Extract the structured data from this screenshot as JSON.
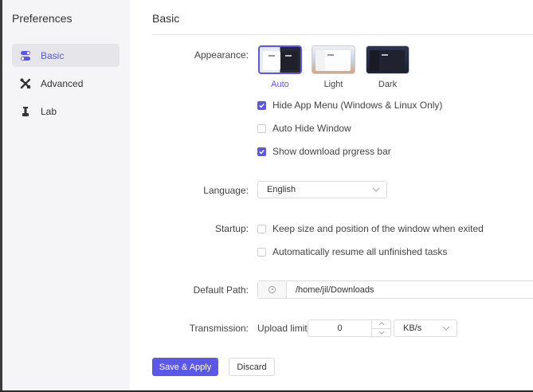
{
  "sidebar": {
    "title": "Preferences",
    "items": [
      {
        "label": "Basic",
        "icon": "toggle-icon",
        "active": true
      },
      {
        "label": "Advanced",
        "icon": "tools-icon",
        "active": false
      },
      {
        "label": "Lab",
        "icon": "flask-icon",
        "active": false
      }
    ]
  },
  "main": {
    "title": "Basic",
    "appearance": {
      "label": "Appearance:",
      "themes": [
        {
          "name": "Auto",
          "selected": true
        },
        {
          "name": "Light",
          "selected": false
        },
        {
          "name": "Dark",
          "selected": false
        }
      ]
    },
    "options": [
      {
        "label": "Hide App Menu (Windows & Linux Only)",
        "checked": true
      },
      {
        "label": "Auto Hide Window",
        "checked": false
      },
      {
        "label": "Show download prgress bar",
        "checked": true
      }
    ],
    "language": {
      "label": "Language:",
      "value": "English"
    },
    "startup": {
      "label": "Startup:",
      "options": [
        {
          "label": "Keep size and position of the window when exited",
          "checked": false
        },
        {
          "label": "Automatically resume all unfinished tasks",
          "checked": false
        }
      ]
    },
    "default_path": {
      "label": "Default Path:",
      "value": "/home/jil/Downloads"
    },
    "transmission": {
      "label": "Transmission:",
      "upload_label": "Upload limit",
      "upload_value": "0",
      "unit": "KB/s"
    },
    "buttons": {
      "save": "Save & Apply",
      "discard": "Discard"
    }
  },
  "colors": {
    "accent": "#5b58e9",
    "sidebar_bg": "#f5f5f7"
  }
}
